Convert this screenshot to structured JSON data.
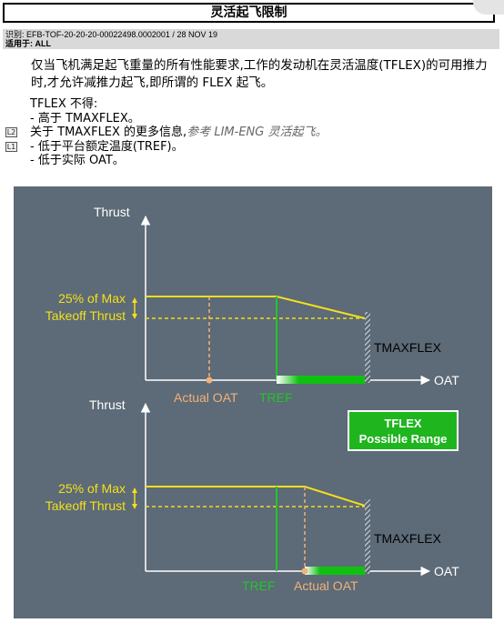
{
  "header": {
    "title": "灵活起飞限制"
  },
  "meta": {
    "ident": "识别: EFB-TOF-20-20-20-00022498.0002001 / 28 NOV 19",
    "applies": "适用于: ALL"
  },
  "intro": "仅当飞机满足起飞重量的所有性能要求,工作的发动机在灵活温度(TFLEX)的可用推力时,才允许减推力起飞,即所谓的 FLEX 起飞。",
  "rules_title": "TFLEX 不得:",
  "rules": [
    {
      "marker": "",
      "text": "- 高于 TMAXFLEX。"
    },
    {
      "marker": "L2",
      "text": "关于 TMAXFLEX 的更多信息,",
      "ref": "参考 LIM-ENG 灵活起飞。"
    },
    {
      "marker": "L1",
      "text": "- 低于平台额定温度(TREF)。"
    },
    {
      "marker": "",
      "text": "- 低于实际 OAT。"
    }
  ],
  "diagram": {
    "top": {
      "y_axis": "Thrust",
      "x_axis": "OAT",
      "thrust_label_1": "25% of Max",
      "thrust_label_2": "Takeoff Thrust",
      "tmaxflex": "TMAXFLEX",
      "actual_oat": "Actual OAT",
      "tref": "TREF"
    },
    "bottom": {
      "y_axis": "Thrust",
      "x_axis": "OAT",
      "thrust_label_1": "25% of Max",
      "thrust_label_2": "Takeoff Thrust",
      "tmaxflex": "TMAXFLEX",
      "actual_oat": "Actual OAT",
      "tref": "TREF"
    },
    "tflex_box": {
      "line1": "TFLEX",
      "line2": "Possible Range"
    },
    "colors": {
      "background": "#5d6a77",
      "thrust": "#f2e01c",
      "actual_oat": "#f0b27a",
      "tref": "#22c52b",
      "range": "#10c010",
      "axis": "#ffffff"
    }
  }
}
